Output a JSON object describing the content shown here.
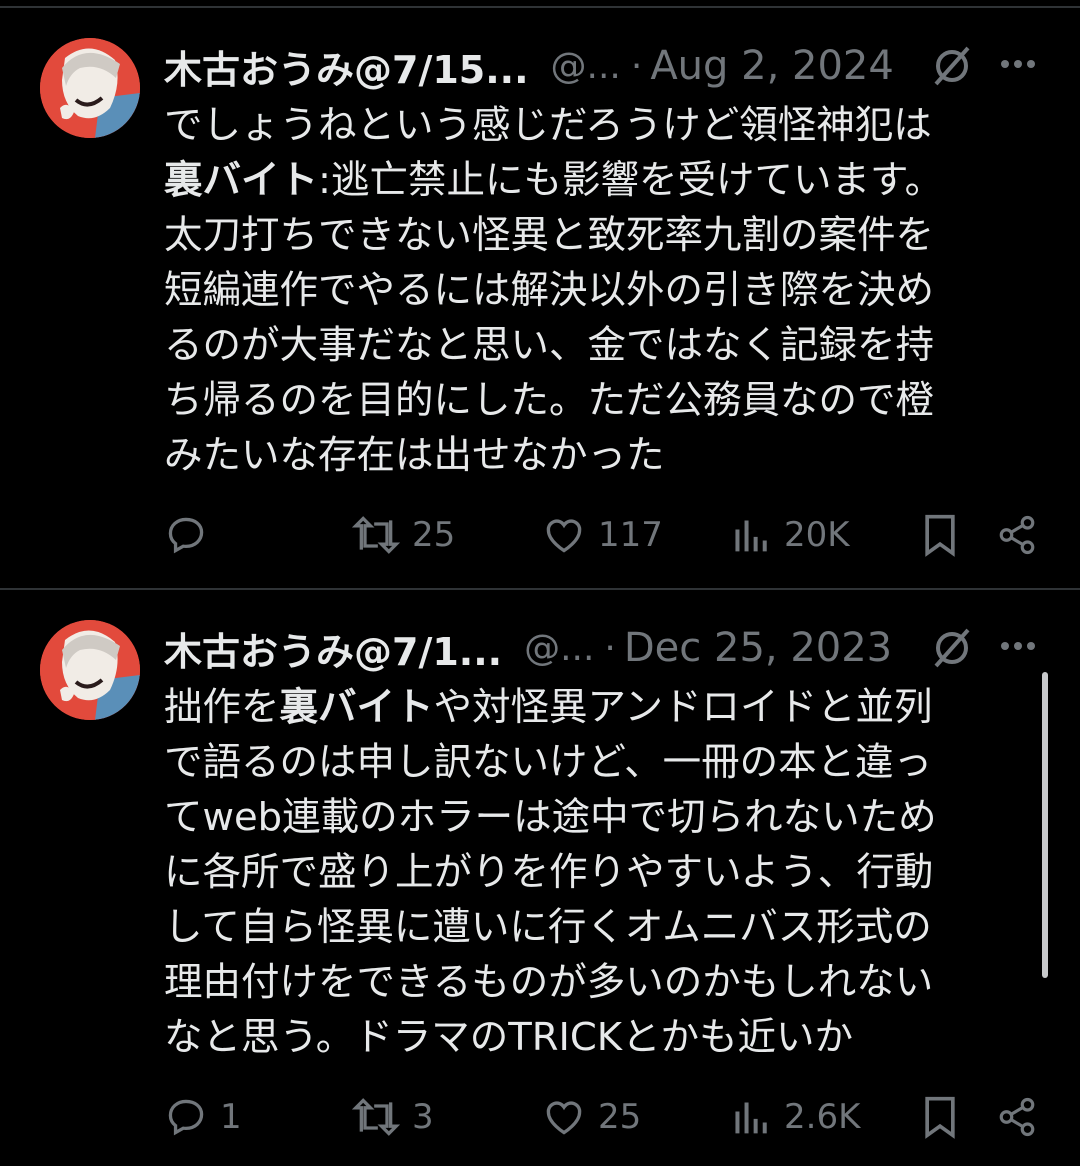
{
  "tweets": [
    {
      "name": "木古おうみ@7/15...",
      "handle": "@...",
      "separator": "·",
      "date": "Aug 2, 2024",
      "text_pre1": "でしょうねという感じだろうけど領怪神犯は\n",
      "text_bold1": "裏バイト",
      "text_post1": ":逃亡禁止にも影響を受けています。\n太刀打ちできない怪異と致死率九割の案件を\n短編連作でやるには解決以外の引き際を決め\nるのが大事だなと思い、金ではなく記録を持\nち帰るのを目的にした。ただ公務員なので橙\nみたいな存在は出せなかった",
      "retweets": "25",
      "likes": "117",
      "views": "20K",
      "replies": ""
    },
    {
      "name": "木古おうみ@7/1...",
      "handle": "@...",
      "separator": "·",
      "date": "Dec 25, 2023",
      "text_pre1": "拙作を",
      "text_bold1": "裏バイト",
      "text_post1": "や対怪異アンドロイドと並列\nで語るのは申し訳ないけど、一冊の本と違っ\nてweb連載のホラーは途中で切られないため\nに各所で盛り上がりを作りやすいよう、行動\nして自ら怪異に遭いに行くオムニバス形式の\n理由付けをできるものが多いのかもしれない\nなと思う。ドラマのTRICKとかも近いか",
      "retweets": "3",
      "likes": "25",
      "views": "2.6K",
      "replies": "1"
    }
  ],
  "icons": {
    "reply": "reply-icon",
    "retweet": "retweet-icon",
    "like": "heart-icon",
    "views": "views-icon",
    "bookmark": "bookmark-icon",
    "share": "share-icon",
    "grok": "grok-icon",
    "more": "more-icon"
  },
  "colors": {
    "background": "#000000",
    "text": "#e7e9ea",
    "muted": "#71767b",
    "avatar_bg": "#e24a3c"
  }
}
